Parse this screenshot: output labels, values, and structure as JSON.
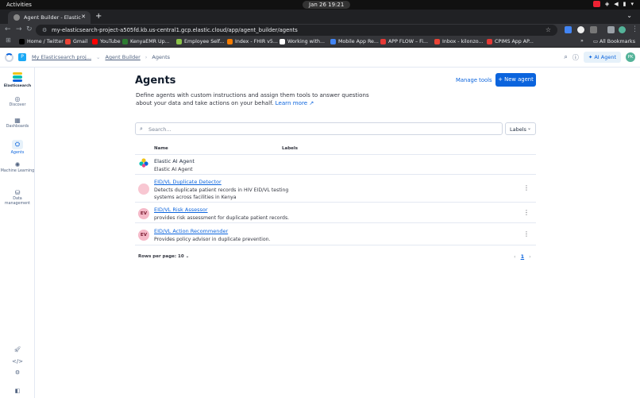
{
  "os": {
    "activities": "Activities",
    "clock": "Jan 26  19:21"
  },
  "browser": {
    "tab_title": "Agent Builder - Elastic",
    "url": "my-elasticsearch-project-a505fd.kb.us-central1.gcp.elastic.cloud/app/agent_builder/agents",
    "bookmarks": [
      {
        "label": "Home / Twitter",
        "color": "#000000"
      },
      {
        "label": "Gmail",
        "color": "#ea4335"
      },
      {
        "label": "YouTube",
        "color": "#ff0000"
      },
      {
        "label": "KenyaEMR Up...",
        "color": "#2e7d32"
      },
      {
        "label": "Employee Self...",
        "color": "#8bc34a"
      },
      {
        "label": "Index - FHIR v5...",
        "color": "#f57c00"
      },
      {
        "label": "Working with...",
        "color": "#ffffff"
      },
      {
        "label": "Mobile App Re...",
        "color": "#4285f4"
      },
      {
        "label": "APP FLOW – Fi...",
        "color": "#e53935"
      },
      {
        "label": "Inbox - kilonzo...",
        "color": "#ea4335"
      },
      {
        "label": "CPIMS App AP...",
        "color": "#e53935"
      }
    ],
    "all_bookmarks": "All Bookmarks"
  },
  "kibana_header": {
    "project": "P",
    "breadcrumbs": {
      "project": "My Elasticsearch proj...",
      "section": "Agent Builder",
      "page": "Agents"
    },
    "ai_agent": "AI Agent",
    "avatar": "PK"
  },
  "sidebar": {
    "brand": "Elasticsearch",
    "items": [
      {
        "label": "Discover",
        "icon": "compass-icon"
      },
      {
        "label": "Dashboards",
        "icon": "dashboard-icon"
      },
      {
        "label": "Agents",
        "icon": "agents-icon"
      },
      {
        "label": "Machine Learning",
        "icon": "ml-icon"
      },
      {
        "label": "Data management",
        "icon": "database-icon"
      }
    ]
  },
  "page": {
    "title": "Agents",
    "manage_tools": "Manage tools",
    "new_agent": "New agent",
    "description": "Define agents with custom instructions and assign them tools to answer questions about your data and take actions on your behalf.",
    "learn_more": "Learn more",
    "search_placeholder": "Search...",
    "labels_filter": "Labels"
  },
  "table": {
    "columns": [
      "Name",
      "Labels"
    ],
    "rows": [
      {
        "name": "Elastic AI Agent",
        "description": "Elastic AI Agent",
        "avatar": "",
        "link": false
      },
      {
        "name": "EID/VL Duplicate Detector",
        "description": "Detects duplicate patient records in HIV EID/VL testing systems across facilities in Kenya",
        "avatar": "",
        "link": true
      },
      {
        "name": "EID/VL Risk Assessor",
        "description": "provides risk assessment for duplicate patient records.",
        "avatar": "EV",
        "link": true
      },
      {
        "name": "EID/VL Action Recommender",
        "description": "Provides policy advisor in duplicate prevention.",
        "avatar": "EV",
        "link": true
      }
    ],
    "rows_per_page": "Rows per page: 10",
    "current_page": "1"
  }
}
